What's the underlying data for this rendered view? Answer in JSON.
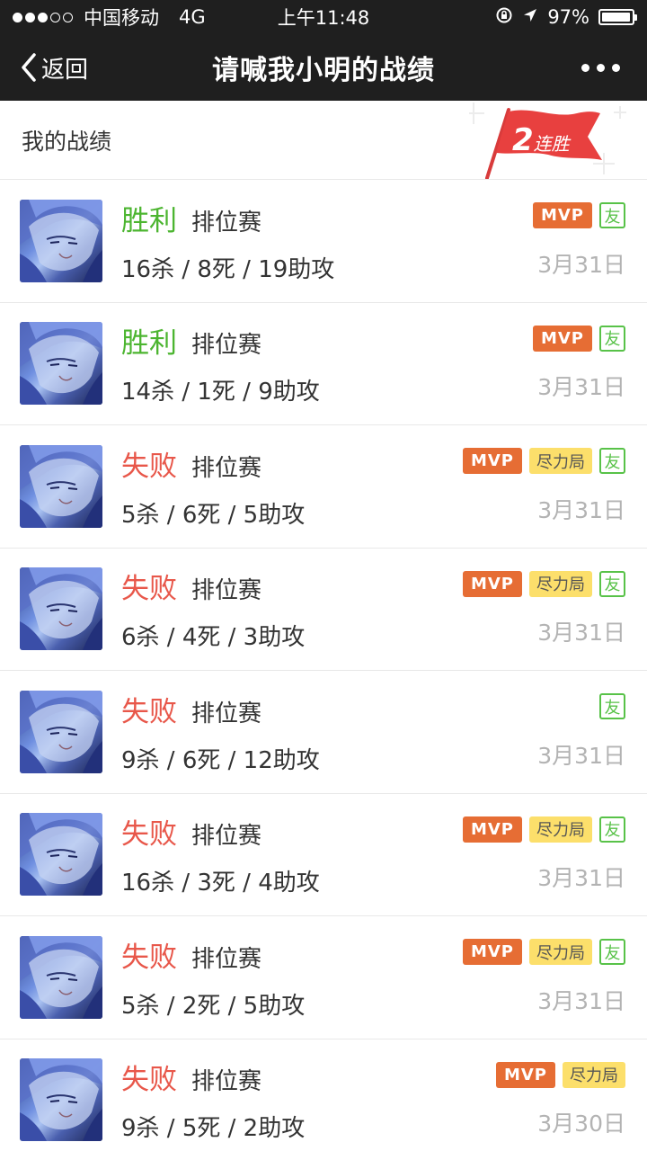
{
  "status_bar": {
    "carrier": "中国移动",
    "network": "4G",
    "time": "上午11:48",
    "battery": "97%",
    "battery_level": 0.97
  },
  "nav": {
    "back_label": "返回",
    "title": "请喊我小明的战绩"
  },
  "section": {
    "title": "我的战绩",
    "streak_num": "2",
    "streak_label": "连胜"
  },
  "tag_labels": {
    "mvp": "MVP",
    "effort": "尽力局",
    "friend": "友"
  },
  "matches": [
    {
      "result": "胜利",
      "outcome": "win",
      "mode": "排位赛",
      "kda": "16杀 / 8死 / 19助攻",
      "date": "3月31日",
      "mvp": true,
      "effort": false,
      "friend": true
    },
    {
      "result": "胜利",
      "outcome": "win",
      "mode": "排位赛",
      "kda": "14杀 / 1死 / 9助攻",
      "date": "3月31日",
      "mvp": true,
      "effort": false,
      "friend": true
    },
    {
      "result": "失败",
      "outcome": "lose",
      "mode": "排位赛",
      "kda": "5杀 / 6死 / 5助攻",
      "date": "3月31日",
      "mvp": true,
      "effort": true,
      "friend": true
    },
    {
      "result": "失败",
      "outcome": "lose",
      "mode": "排位赛",
      "kda": "6杀 / 4死 / 3助攻",
      "date": "3月31日",
      "mvp": true,
      "effort": true,
      "friend": true
    },
    {
      "result": "失败",
      "outcome": "lose",
      "mode": "排位赛",
      "kda": "9杀 / 6死 / 12助攻",
      "date": "3月31日",
      "mvp": false,
      "effort": false,
      "friend": true
    },
    {
      "result": "失败",
      "outcome": "lose",
      "mode": "排位赛",
      "kda": "16杀 / 3死 / 4助攻",
      "date": "3月31日",
      "mvp": true,
      "effort": true,
      "friend": true
    },
    {
      "result": "失败",
      "outcome": "lose",
      "mode": "排位赛",
      "kda": "5杀 / 2死 / 5助攻",
      "date": "3月31日",
      "mvp": true,
      "effort": true,
      "friend": true
    },
    {
      "result": "失败",
      "outcome": "lose",
      "mode": "排位赛",
      "kda": "9杀 / 5死 / 2助攻",
      "date": "3月30日",
      "mvp": true,
      "effort": true,
      "friend": false
    }
  ]
}
